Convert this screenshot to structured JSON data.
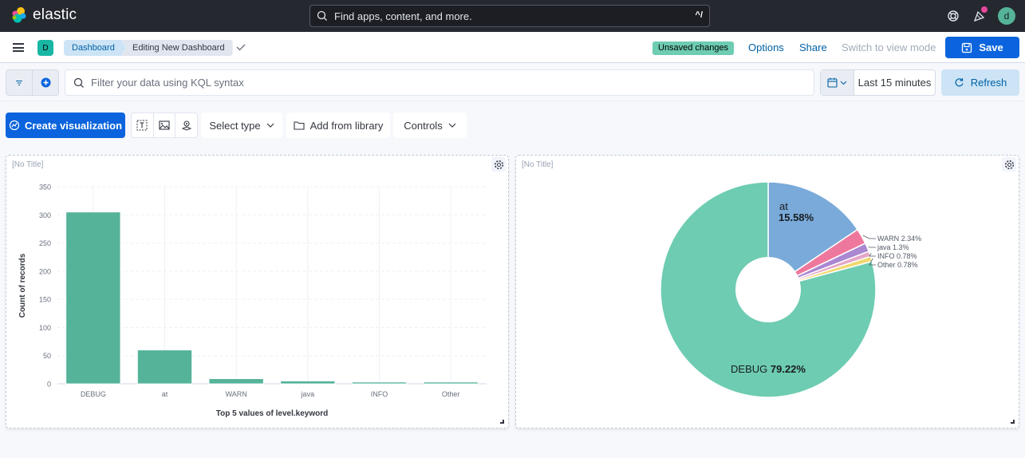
{
  "header": {
    "brand": "elastic",
    "search_placeholder": "Find apps, content, and more.",
    "search_shortcut": "^/",
    "user_initial": "d",
    "icons": [
      "help-icon",
      "news-feed-icon"
    ]
  },
  "nav": {
    "space_initial": "D",
    "breadcrumbs": [
      "Dashboard",
      "Editing New Dashboard"
    ],
    "unsaved_badge": "Unsaved changes",
    "options": "Options",
    "share": "Share",
    "switch_view": "Switch to view mode",
    "save": "Save"
  },
  "query": {
    "kql_placeholder": "Filter your data using KQL syntax",
    "time_range": "Last 15 minutes",
    "refresh": "Refresh"
  },
  "toolbar": {
    "create_visualization": "Create visualization",
    "select_type": "Select type",
    "add_from_library": "Add from library",
    "controls": "Controls"
  },
  "panels": [
    {
      "title": "[No Title]"
    },
    {
      "title": "[No Title]"
    }
  ],
  "colors": {
    "accent": "#0b64dd",
    "bar": "#54b399",
    "pie": [
      "#6dccb1",
      "#79aad9",
      "#ee789d",
      "#a987d1",
      "#e4a6c7",
      "#f1d86f"
    ]
  },
  "chart_data": [
    {
      "type": "bar",
      "title": "[No Title]",
      "categories": [
        "DEBUG",
        "at",
        "WARN",
        "java",
        "INFO",
        "Other"
      ],
      "values": [
        305,
        60,
        9,
        5,
        3,
        3
      ],
      "xlabel": "Top 5 values of level.keyword",
      "ylabel": "Count of records",
      "ylim": [
        0,
        350
      ],
      "yticks": [
        0,
        50,
        100,
        150,
        200,
        250,
        300,
        350
      ],
      "grid": true
    },
    {
      "type": "pie",
      "title": "[No Title]",
      "donut": true,
      "slices": [
        {
          "label": "DEBUG",
          "percent": 79.22,
          "display": "79.22%"
        },
        {
          "label": "at",
          "percent": 15.58,
          "display": "15.58%"
        },
        {
          "label": "WARN",
          "percent": 2.34,
          "display": "2.34%"
        },
        {
          "label": "java",
          "percent": 1.3,
          "display": "1.3%"
        },
        {
          "label": "INFO",
          "percent": 0.78,
          "display": "0.78%"
        },
        {
          "label": "Other",
          "percent": 0.78,
          "display": "0.78%"
        }
      ]
    }
  ]
}
